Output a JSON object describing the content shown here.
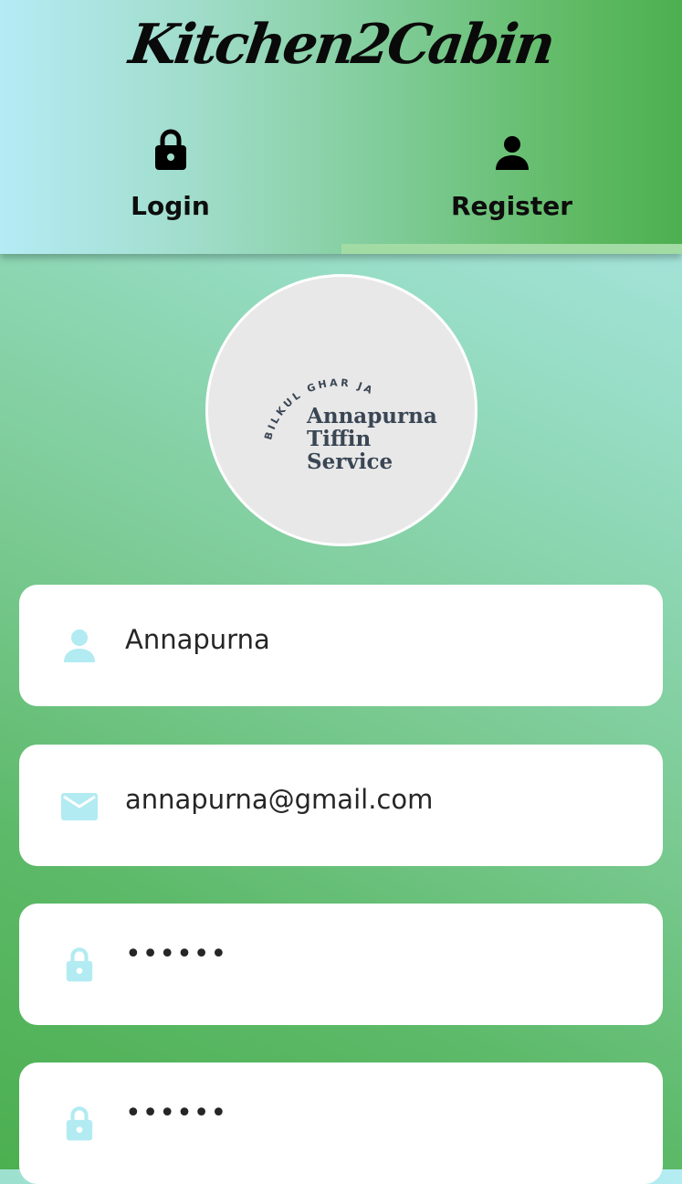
{
  "app": {
    "title": "Kitchen2Cabin"
  },
  "tabs": [
    {
      "label": "Login",
      "icon": "lock-icon",
      "selected": false
    },
    {
      "label": "Register",
      "icon": "person-icon",
      "selected": true
    }
  ],
  "logo": {
    "tagline": "BILKUL GHAR JAISA!",
    "brand_line1": "Annapurna",
    "brand_line2": "Tiffin",
    "brand_line3": "Service"
  },
  "form": {
    "name": {
      "value": "Annapurna",
      "icon": "person-icon"
    },
    "email": {
      "value": "annapurna@gmail.com",
      "icon": "mail-icon"
    },
    "password": {
      "value": "••••••",
      "icon": "lock-icon"
    },
    "confirm_password": {
      "value": "••••••",
      "icon": "lock-icon"
    }
  },
  "colors": {
    "accent_icon": "#b2ebf2",
    "tab_indicator": "#a2dca4",
    "gradient_green": "#4caf50",
    "gradient_cyan": "#b2ebf2"
  }
}
